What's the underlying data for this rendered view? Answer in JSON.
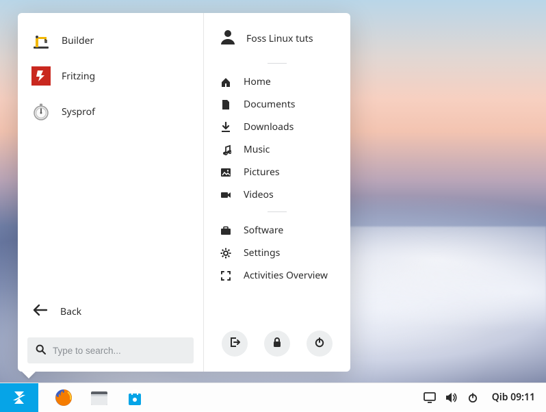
{
  "user": {
    "name": "Foss Linux tuts"
  },
  "apps": [
    {
      "name": "Builder",
      "icon": "builder"
    },
    {
      "name": "Fritzing",
      "icon": "fritzing"
    },
    {
      "name": "Sysprof",
      "icon": "sysprof"
    }
  ],
  "back_label": "Back",
  "search": {
    "placeholder": "Type to search..."
  },
  "places": [
    {
      "label": "Home",
      "icon": "home"
    },
    {
      "label": "Documents",
      "icon": "document"
    },
    {
      "label": "Downloads",
      "icon": "download"
    },
    {
      "label": "Music",
      "icon": "music"
    },
    {
      "label": "Pictures",
      "icon": "picture"
    },
    {
      "label": "Videos",
      "icon": "video"
    }
  ],
  "system": [
    {
      "label": "Software",
      "icon": "briefcase"
    },
    {
      "label": "Settings",
      "icon": "gear"
    },
    {
      "label": "Activities Overview",
      "icon": "fullscreen"
    }
  ],
  "clock": "Qib 09:11"
}
